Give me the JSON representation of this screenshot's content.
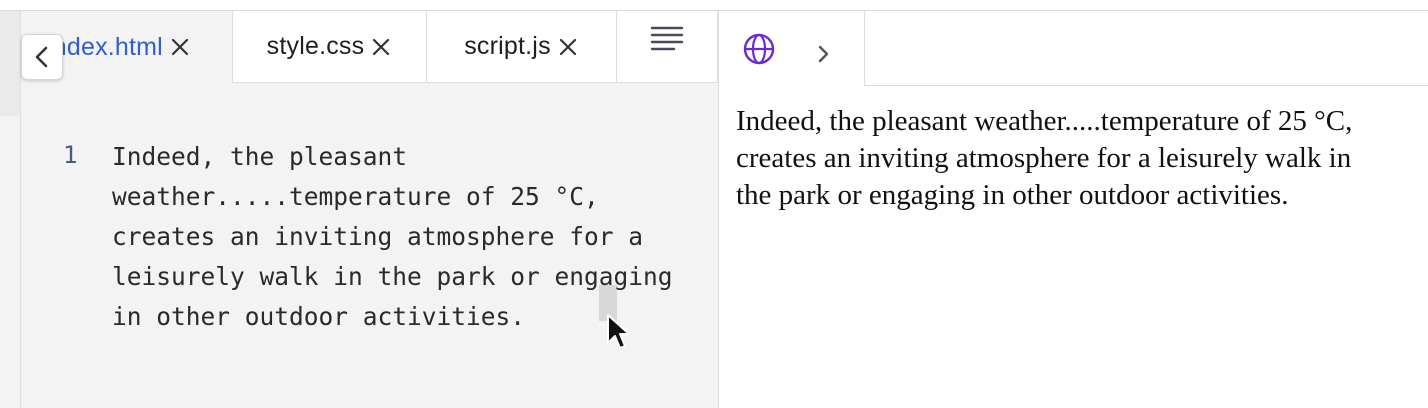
{
  "tabs": [
    {
      "label": "index.html",
      "active": true
    },
    {
      "label": "style.css",
      "active": false
    },
    {
      "label": "script.js",
      "active": false
    }
  ],
  "icons": {
    "back": "chevron-left-icon",
    "close": "close-icon",
    "format": "align-lines-icon",
    "globe": "globe-icon",
    "forward": "chevron-right-icon"
  },
  "colors": {
    "active_tab_text": "#2f5fcf",
    "globe": "#6a2bd6",
    "editor_bg": "#f3f3f3"
  },
  "editor": {
    "line_number": "1",
    "code": "Indeed, the pleasant weather.....temperature of 25 °C, creates an inviting atmosphere for a leisurely walk in the park or engaging in other outdoor activities."
  },
  "preview": {
    "text": "Indeed, the pleasant weather.....temperature of 25 °C, creates an inviting atmosphere for a leisurely walk in the park or engaging in other outdoor activities."
  }
}
